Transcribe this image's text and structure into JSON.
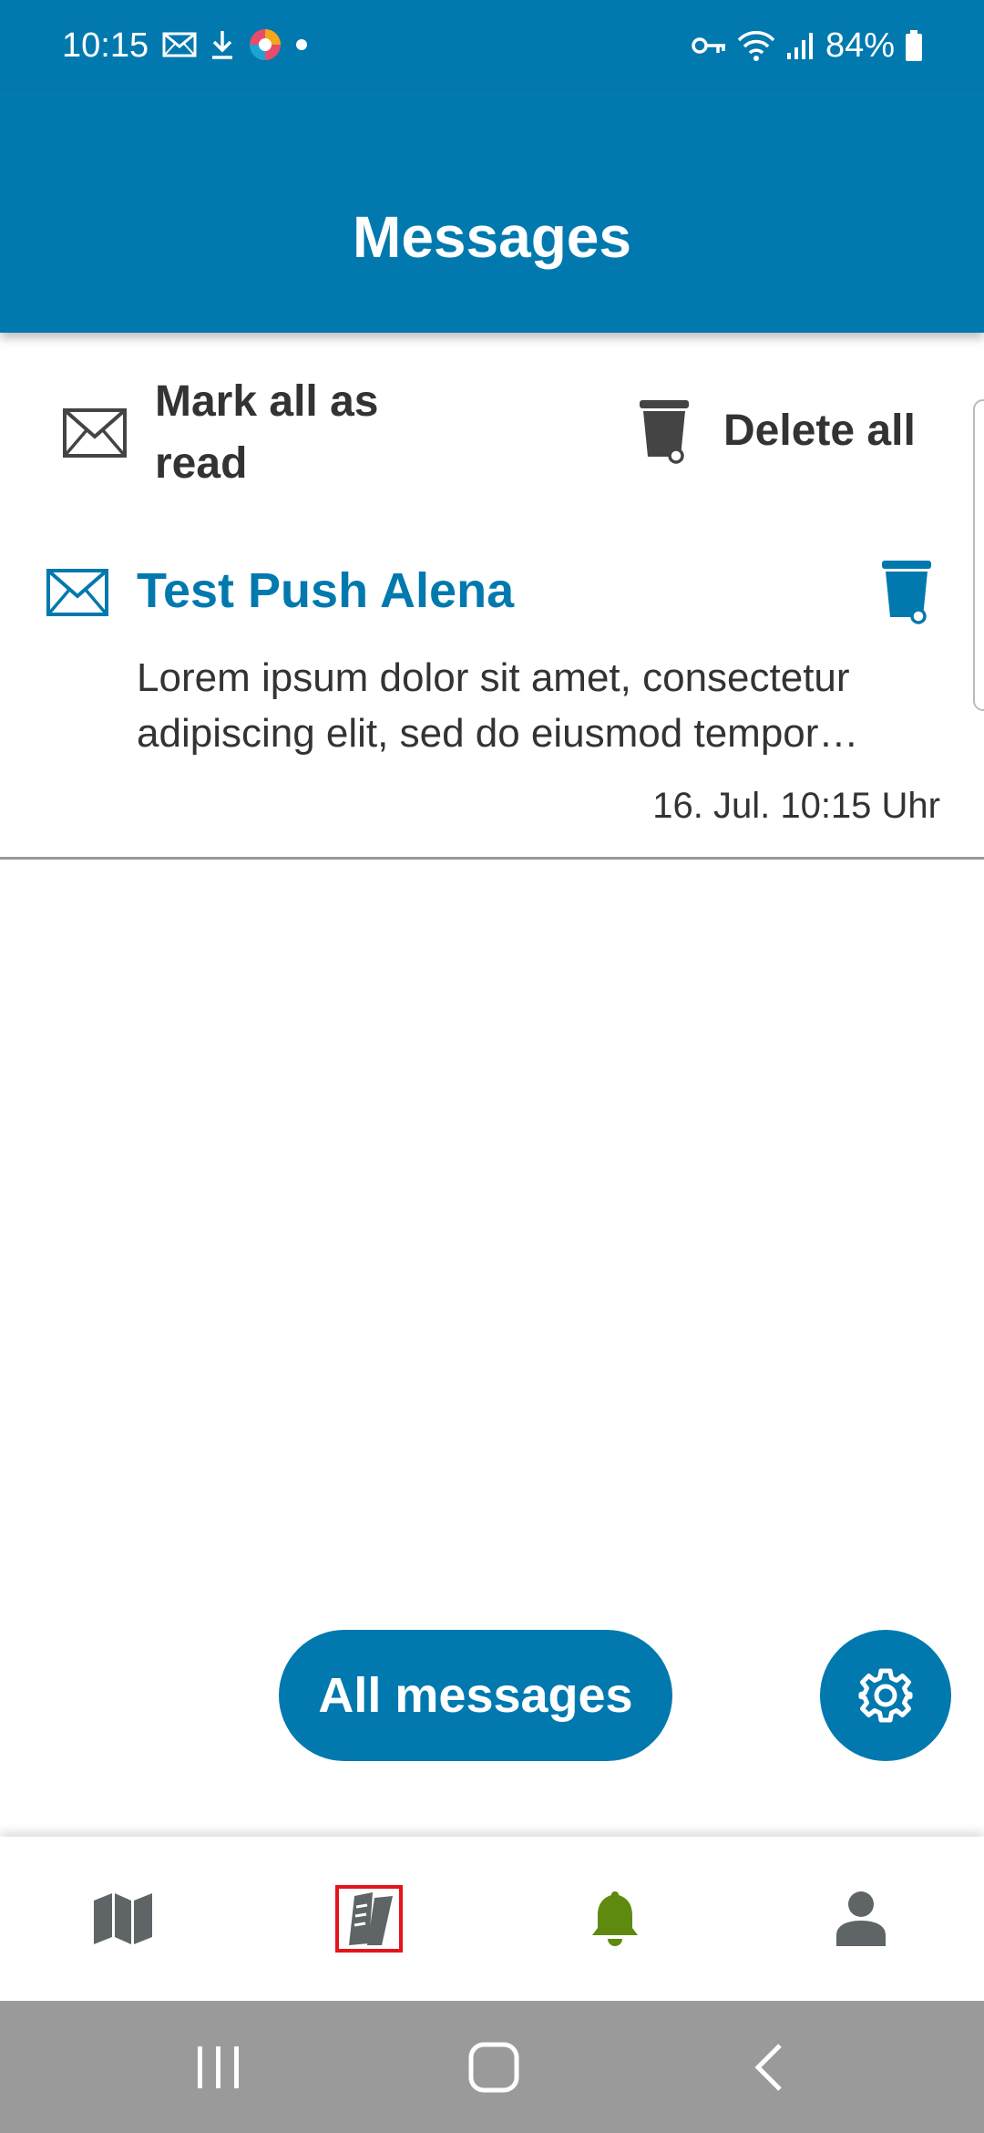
{
  "status_bar": {
    "time": "10:15",
    "battery": "84%",
    "left_icons": [
      "mail-icon",
      "download-icon",
      "browser-icon",
      "dot-icon"
    ],
    "right_icons": [
      "vpn-key-icon",
      "wifi-icon",
      "signal-icon",
      "battery-icon"
    ]
  },
  "header": {
    "title": "Messages"
  },
  "actions": {
    "mark_all_label": "Mark all as read",
    "delete_all_label": "Delete all"
  },
  "messages": [
    {
      "title": "Test Push Alena",
      "body": "Lorem ipsum dolor sit amet, consectetur adipiscing elit, sed do eiusmod tempor incididunt ut labore et dolore magna aliqua.",
      "timestamp": "16. Jul. 10:15 Uhr"
    }
  ],
  "footer_buttons": {
    "all_messages_label": "All messages",
    "settings_icon": "gear-icon"
  },
  "bottom_nav": {
    "items": [
      {
        "name": "map",
        "icon": "map-icon",
        "active": false
      },
      {
        "name": "tickets",
        "icon": "tickets-icon",
        "active": false,
        "highlighted": true
      },
      {
        "name": "notifications",
        "icon": "bell-icon",
        "active": true
      },
      {
        "name": "profile",
        "icon": "person-icon",
        "active": false
      }
    ]
  },
  "colors": {
    "primary": "#0279ae",
    "active_nav": "#5d8a0f",
    "inactive_nav": "#5f6466",
    "text": "#333333",
    "highlight": "#e3151a",
    "system_nav": "#9a9a9a"
  },
  "system_nav": {
    "buttons": [
      "recent-apps-icon",
      "home-icon",
      "back-icon"
    ]
  }
}
